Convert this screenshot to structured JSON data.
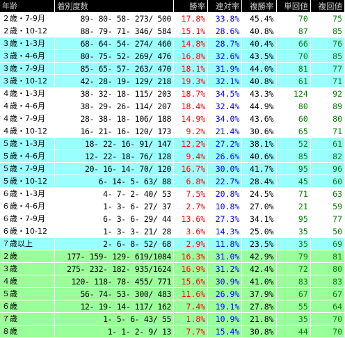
{
  "header": [
    "年齢",
    "着別度数",
    "勝率",
    "連対率",
    "複勝率",
    "単回値",
    "複回値"
  ],
  "rows": [
    {
      "label": "２歳・7-9月",
      "counts": "89-   80-   58- 273/ 500",
      "win": "17.8%",
      "rentai": "33.8%",
      "fuku": "45.4%",
      "tan": "70",
      "fukukai": "75",
      "bg": "white"
    },
    {
      "label": "２歳・10-12",
      "counts": "88-   79-   71- 346/ 584",
      "win": "15.1%",
      "rentai": "28.6%",
      "fuku": "40.8%",
      "tan": "87",
      "fukukai": "85",
      "bg": "white"
    },
    {
      "label": "３歳・1-3月",
      "counts": "68-   64-   54- 274/ 460",
      "win": "14.8%",
      "rentai": "28.7%",
      "fuku": "40.4%",
      "tan": "66",
      "fukukai": "76",
      "bg": "cyan"
    },
    {
      "label": "３歳・4-6月",
      "counts": "80-   75-   52- 269/ 476",
      "win": "16.8%",
      "rentai": "32.6%",
      "fuku": "43.5%",
      "tan": "70",
      "fukukai": "85",
      "bg": "cyan"
    },
    {
      "label": "３歳・7-9月",
      "counts": "85-   65-   57- 263/ 470",
      "win": "18.1%",
      "rentai": "31.9%",
      "fuku": "44.0%",
      "tan": "81",
      "fukukai": "77",
      "bg": "cyan"
    },
    {
      "label": "３歳・10-12",
      "counts": "42-   28-   19- 129/ 218",
      "win": "19.3%",
      "rentai": "32.1%",
      "fuku": "40.8%",
      "tan": "61",
      "fukukai": "71",
      "bg": "cyan"
    },
    {
      "label": "４歳・1-3月",
      "counts": "38-   32-   18- 115/ 203",
      "win": "18.7%",
      "rentai": "34.5%",
      "fuku": "43.3%",
      "tan": "124",
      "fukukai": "92",
      "bg": "white"
    },
    {
      "label": "４歳・4-6月",
      "counts": "38-   29-   26- 114/ 207",
      "win": "18.4%",
      "rentai": "32.4%",
      "fuku": "44.9%",
      "tan": "80",
      "fukukai": "89",
      "bg": "white"
    },
    {
      "label": "４歳・7-9月",
      "counts": "28-   38-   18- 106/ 188",
      "win": "14.9%",
      "rentai": "34.0%",
      "fuku": "43.6%",
      "tan": "60",
      "fukukai": "80",
      "bg": "white"
    },
    {
      "label": "４歳・10-12",
      "counts": "16-   21-   16- 120/ 173",
      "win": "9.2%",
      "rentai": "21.4%",
      "fuku": "30.6%",
      "tan": "65",
      "fukukai": "71",
      "bg": "white"
    },
    {
      "label": "５歳・1-3月",
      "counts": "18-   22-   16-  91/ 147",
      "win": "12.2%",
      "rentai": "27.2%",
      "fuku": "38.1%",
      "tan": "52",
      "fukukai": "61",
      "bg": "cyan"
    },
    {
      "label": "５歳・4-6月",
      "counts": "12-   22-   18-  76/ 128",
      "win": "9.4%",
      "rentai": "26.6%",
      "fuku": "40.6%",
      "tan": "85",
      "fukukai": "82",
      "bg": "cyan"
    },
    {
      "label": "５歳・7-9月",
      "counts": "20-   16-   14-  70/ 120",
      "win": "16.7%",
      "rentai": "30.0%",
      "fuku": "41.7%",
      "tan": "95",
      "fukukai": "96",
      "bg": "cyan"
    },
    {
      "label": "５歳・10-12",
      "counts": "6-   14-    5-  63/  88",
      "win": "6.8%",
      "rentai": "22.7%",
      "fuku": "28.4%",
      "tan": "45",
      "fukukai": "60",
      "bg": "cyan"
    },
    {
      "label": "６歳・1-3月",
      "counts": "4-    7-    2-  40/  53",
      "win": "7.5%",
      "rentai": "20.8%",
      "fuku": "24.5%",
      "tan": "71",
      "fukukai": "63",
      "bg": "white"
    },
    {
      "label": "６歳・4-6月",
      "counts": "1-    3-    6-  27/  37",
      "win": "2.7%",
      "rentai": "10.8%",
      "fuku": "27.0%",
      "tan": "21",
      "fukukai": "59",
      "bg": "white"
    },
    {
      "label": "６歳・7-9月",
      "counts": "6-    3-    6-  29/  44",
      "win": "13.6%",
      "rentai": "27.3%",
      "fuku": "34.1%",
      "tan": "95",
      "fukukai": "77",
      "bg": "white"
    },
    {
      "label": "６歳・10-12",
      "counts": "1-    3-    3-  21/  28",
      "win": "3.6%",
      "rentai": "14.3%",
      "fuku": "25.0%",
      "tan": "35",
      "fukukai": "50",
      "bg": "white"
    },
    {
      "label": "７歳以上",
      "counts": "2-    6-    8-  52/  68",
      "win": "2.9%",
      "rentai": "11.8%",
      "fuku": "23.5%",
      "tan": "35",
      "fukukai": "69",
      "bg": "cyan"
    },
    {
      "label": "２歳",
      "counts": "177-  159-  129- 619/1084",
      "win": "16.3%",
      "rentai": "31.0%",
      "fuku": "42.9%",
      "tan": "79",
      "fukukai": "81",
      "bg": "green"
    },
    {
      "label": "３歳",
      "counts": "275-  232-  182- 935/1624",
      "win": "16.9%",
      "rentai": "31.2%",
      "fuku": "42.4%",
      "tan": "72",
      "fukukai": "80",
      "bg": "green"
    },
    {
      "label": "４歳",
      "counts": "120-  118-   78- 455/ 771",
      "win": "15.6%",
      "rentai": "30.9%",
      "fuku": "41.0%",
      "tan": "83",
      "fukukai": "83",
      "bg": "green"
    },
    {
      "label": "５歳",
      "counts": "56-   74-   53- 300/ 483",
      "win": "11.6%",
      "rentai": "26.9%",
      "fuku": "37.9%",
      "tan": "67",
      "fukukai": "67",
      "bg": "green"
    },
    {
      "label": "６歳",
      "counts": "12-   19-   14- 117/ 162",
      "win": "7.4%",
      "rentai": "19.1%",
      "fuku": "27.8%",
      "tan": "55",
      "fukukai": "64",
      "bg": "green"
    },
    {
      "label": "７歳",
      "counts": "1-    5-    6-  43/  55",
      "win": "1.8%",
      "rentai": "10.9%",
      "fuku": "21.8%",
      "tan": "35",
      "fukukai": "70",
      "bg": "green"
    },
    {
      "label": "８歳",
      "counts": "1-    1-    2-   9/  13",
      "win": "7.7%",
      "rentai": "15.4%",
      "fuku": "30.8%",
      "tan": "44",
      "fukukai": "70",
      "bg": "green"
    }
  ]
}
